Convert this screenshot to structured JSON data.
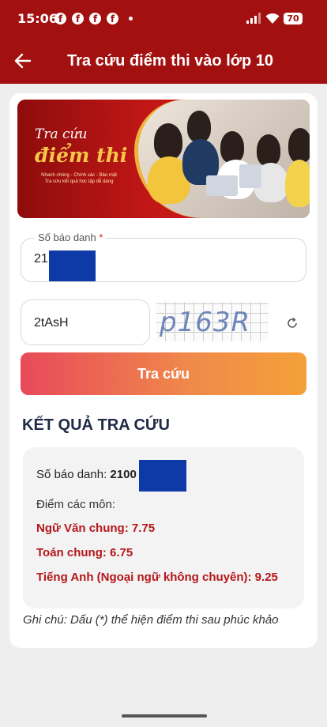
{
  "status_bar": {
    "time": "15:06",
    "battery": "70"
  },
  "header": {
    "title": "Tra cứu điểm thi vào lớp 10"
  },
  "banner": {
    "line1": "Tra cứu",
    "line2": "điểm thi",
    "line3": "Nhanh chóng - Chính xác - Bảo mật",
    "line4": "Tra cứu kết quả học tập dễ dàng"
  },
  "form": {
    "sbd_label": "Số báo danh",
    "sbd_required": "*",
    "sbd_value": "21",
    "captcha_value": "2tAsH",
    "captcha_text": "p163R",
    "submit_label": "Tra cứu"
  },
  "results": {
    "section_title": "KẾT QUẢ TRA CỨU",
    "sbd_label": "Số báo danh:",
    "sbd_value": "2100",
    "subjects_label": "Điểm các môn:",
    "scores": [
      "Ngữ Văn chung: 7.75",
      "Toán chung: 6.75",
      "Tiếng Anh (Ngoại ngữ không chuyên): 9.25"
    ],
    "note": "Ghi chú: Dấu (*) thể hiện điểm thi sau phúc khảo"
  },
  "colors": {
    "brand_red": "#a31010",
    "score_red": "#b5161a",
    "button_start": "#e8495a",
    "button_end": "#f4a039"
  }
}
